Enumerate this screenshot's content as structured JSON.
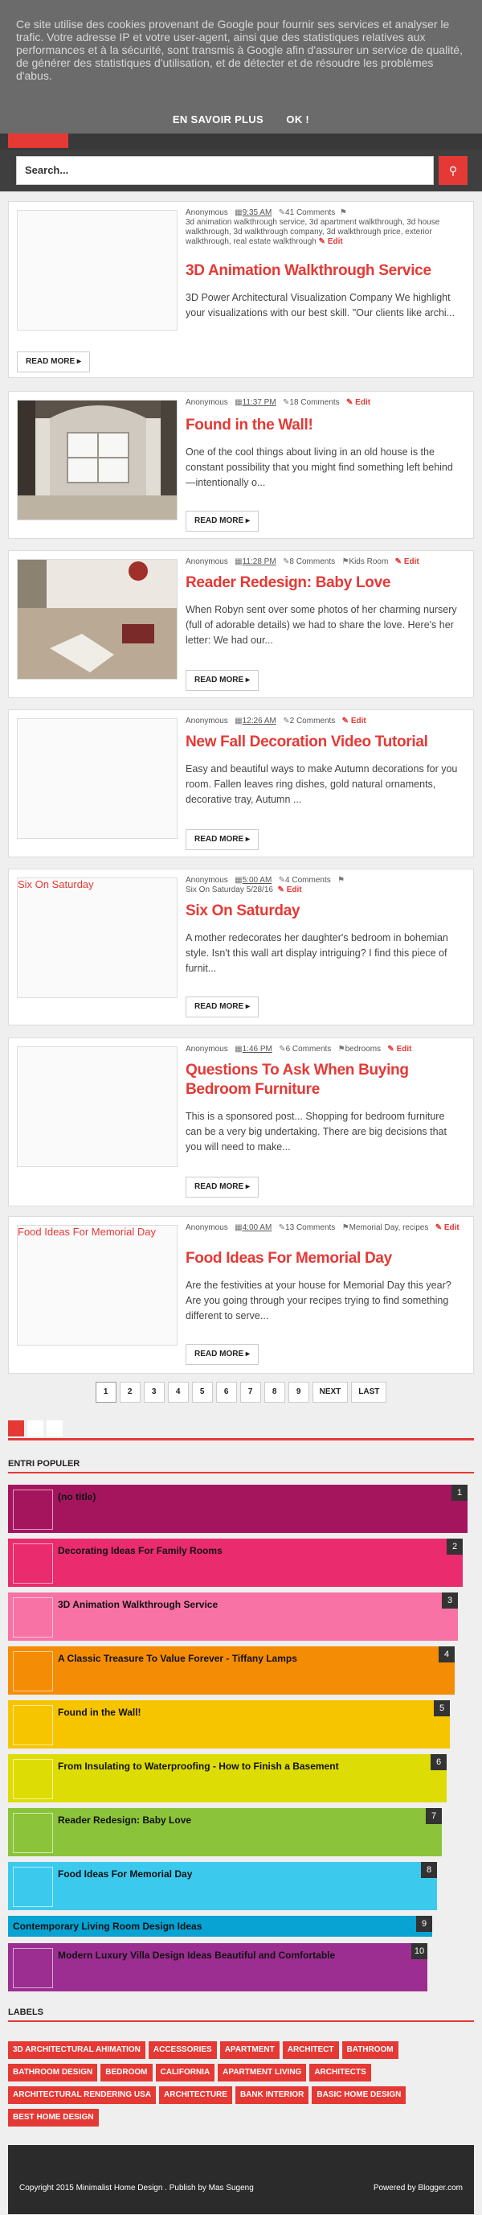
{
  "cookie": {
    "message": "Ce site utilise des cookies provenant de Google pour fournir ses services et analyser le trafic. Votre adresse IP et votre user-agent, ainsi que des statistiques relatives aux performances et à la sécurité, sont transmis à Google afin d'assurer un service de qualité, de générer des statistiques d'utilisation, et de détecter et de résoudre les problèmes d'abus.",
    "learn_more": "EN SAVOIR PLUS",
    "ok": "OK !"
  },
  "search": {
    "placeholder": "Search..."
  },
  "read_more": "READ MORE ▸",
  "edit_label": "Edit",
  "posts": [
    {
      "author": "Anonymous",
      "time": "9:35 AM",
      "comments": "41 Comments",
      "labels": "3d animation walkthrough service, 3d apartment walkthrough, 3d house walkthrough, 3d walkthrough company, 3d walkthrough price, exterior walkthrough, real estate walkthrough",
      "title": "3D Animation Walkthrough Service",
      "excerpt": "3D Power Architectural Visualization Company We highlight your visualizations with our best skill. \"Our clients like archi...",
      "thumb_label": ""
    },
    {
      "author": "Anonymous",
      "time": "11:37 PM",
      "comments": "18 Comments",
      "labels": "",
      "title": "Found in the Wall!",
      "excerpt": "One of the cool things about living in an old house is the constant  possibility  that you might find something left behind—intentionally o...",
      "thumb_label": ""
    },
    {
      "author": "Anonymous",
      "time": "11:28 PM",
      "comments": "8 Comments",
      "labels": "Kids Room",
      "title": "Reader Redesign: Baby Love",
      "excerpt": "When Robyn sent over some photos of her charming nursery (full of adorable details) we had to share the love. Here's her letter: We had our...",
      "thumb_label": ""
    },
    {
      "author": "Anonymous",
      "time": "12:26 AM",
      "comments": "2 Comments",
      "labels": "",
      "title": "New Fall Decoration Video Tutorial",
      "excerpt": "Easy and beautiful ways to make Autumn decorations for you room. Fallen leaves ring dishes, gold natural ornaments, decorative tray, Autumn ...",
      "thumb_label": ""
    },
    {
      "author": "Anonymous",
      "time": "5:00 AM",
      "comments": "4 Comments",
      "labels": "Six On Saturday 5/28/16",
      "title": "Six On Saturday",
      "excerpt": "A mother redecorates her daughter's bedroom  in bohemian style. Isn't this wall art display intriguing? I find this piece of furnit...",
      "thumb_label": "Six On Saturday"
    },
    {
      "author": "Anonymous",
      "time": "1:46 PM",
      "comments": "6 Comments",
      "labels": "bedrooms",
      "title": "Questions To Ask When Buying Bedroom Furniture",
      "excerpt": "This is a sponsored post... Shopping for bedroom furniture can be a very big undertaking. There are big decisions that you will need to make...",
      "thumb_label": ""
    },
    {
      "author": "Anonymous",
      "time": "4:00 AM",
      "comments": "13 Comments",
      "labels": "Memorial Day, recipes",
      "title": "Food Ideas For Memorial Day",
      "excerpt": "Are the festivities at your house for Memorial Day this year? Are you going through your recipes trying to find something different to serve...",
      "thumb_label": "Food Ideas For Memorial Day"
    }
  ],
  "pager": [
    "1",
    "2",
    "3",
    "4",
    "5",
    "6",
    "7",
    "8",
    "9",
    "NEXT",
    "LAST"
  ],
  "popular": {
    "heading": "ENTRI POPULER",
    "items": [
      {
        "num": "1",
        "title": "(no title)",
        "color": "#a5155e"
      },
      {
        "num": "2",
        "title": "Decorating Ideas For Family Rooms",
        "color": "#ea2b6e"
      },
      {
        "num": "3",
        "title": "3D Animation Walkthrough Service",
        "color": "#f872a6"
      },
      {
        "num": "4",
        "title": "A Classic Treasure To Value Forever - Tiffany Lamps",
        "color": "#f48c06"
      },
      {
        "num": "5",
        "title": "Found in the Wall!",
        "color": "#f7c500"
      },
      {
        "num": "6",
        "title": "From Insulating to Waterproofing - How to Finish a Basement",
        "color": "#dedc05"
      },
      {
        "num": "7",
        "title": "Reader Redesign: Baby Love",
        "color": "#8bc43a"
      },
      {
        "num": "8",
        "title": "Food Ideas For Memorial Day",
        "color": "#3cc9ee"
      },
      {
        "num": "9",
        "title": "Contemporary Living Room Design Ideas",
        "color": "#08a3d3"
      },
      {
        "num": "10",
        "title": "Modern Luxury Villa Design Ideas Beautiful and Comfortable",
        "color": "#9c2e91"
      }
    ]
  },
  "labels": {
    "heading": "LABELS",
    "items": [
      "3D ARCHITECTURAL AHIMATION",
      "ACCESSORIES",
      "APARTMENT",
      "ARCHITECT",
      "BATHROOM",
      "BATHROOM DESIGN",
      "BEDROOM",
      "CALIFORNIA",
      "APARTMENT LIVING",
      "ARCHITECTS",
      "ARCHITECTURAL RENDERING USA",
      "ARCHITECTURE",
      "BANK INTERIOR",
      "BASIC HOME DESIGN",
      "BEST HOME DESIGN"
    ]
  },
  "footer": {
    "left": "Copyright 2015 Minimalist Home Design . Publish by Mas Sugeng",
    "right": "Powered by Blogger.com"
  },
  "colors": {
    "accent": "#e53935"
  }
}
